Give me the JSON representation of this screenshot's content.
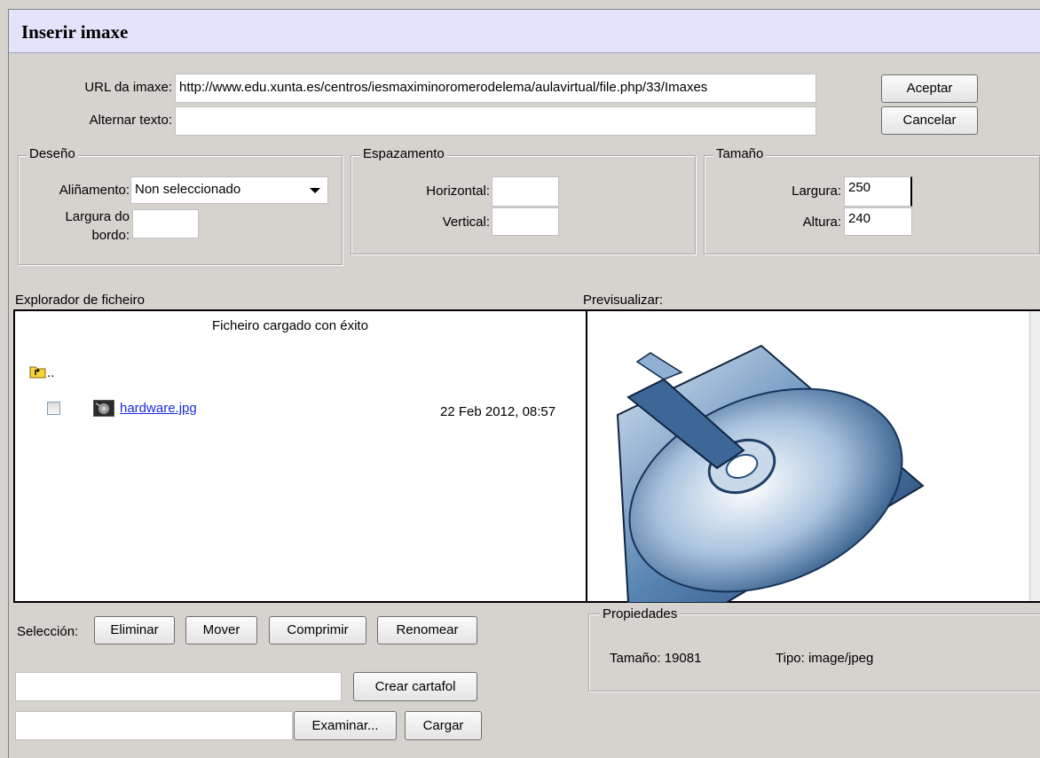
{
  "dialog": {
    "title": "Inserir imaxe"
  },
  "url": {
    "label": "URL da imaxe:",
    "value": "http://www.edu.xunta.es/centros/iesmaximinoromerodelema/aulavirtual/file.php/33/Imaxes"
  },
  "alt": {
    "label": "Alternar texto:",
    "value": ""
  },
  "buttons": {
    "accept": "Aceptar",
    "cancel": "Cancelar"
  },
  "design": {
    "legend": "Deseño",
    "align_label": "Aliñamento:",
    "align_value": "Non seleccionado",
    "border_label_1": "Largura do",
    "border_label_2": "bordo:",
    "border_value": ""
  },
  "spacing": {
    "legend": "Espazamento",
    "horizontal_label": "Horizontal:",
    "horizontal_value": "",
    "vertical_label": "Vertical:",
    "vertical_value": ""
  },
  "size": {
    "legend": "Tamaño",
    "width_label": "Largura:",
    "width_value": "250",
    "height_label": "Altura:",
    "height_value": "240"
  },
  "browser": {
    "label": "Explorador de ficheiro",
    "message": "Ficheiro cargado con éxito",
    "parent": "..",
    "files": [
      {
        "name": "hardware.jpg",
        "date": "22 Feb 2012, 08:57",
        "checked": false
      }
    ]
  },
  "preview": {
    "label": "Previsualizar:"
  },
  "selection": {
    "label": "Selección:",
    "delete": "Eliminar",
    "move": "Mover",
    "zip": "Comprimir",
    "rename": "Renomear"
  },
  "properties": {
    "legend": "Propiedades",
    "size_label": "Tamaño:",
    "size_value": "19081",
    "type_label": "Tipo:",
    "type_value": "image/jpeg"
  },
  "folder": {
    "input_value": "",
    "create_button": "Crear cartafol"
  },
  "upload": {
    "input_value": "",
    "browse_button": "Examinar...",
    "upload_button": "Cargar"
  },
  "icons": {
    "parent_folder": "folder-up-icon",
    "file": "image-file-icon",
    "dropdown": "chevron-down-icon"
  }
}
